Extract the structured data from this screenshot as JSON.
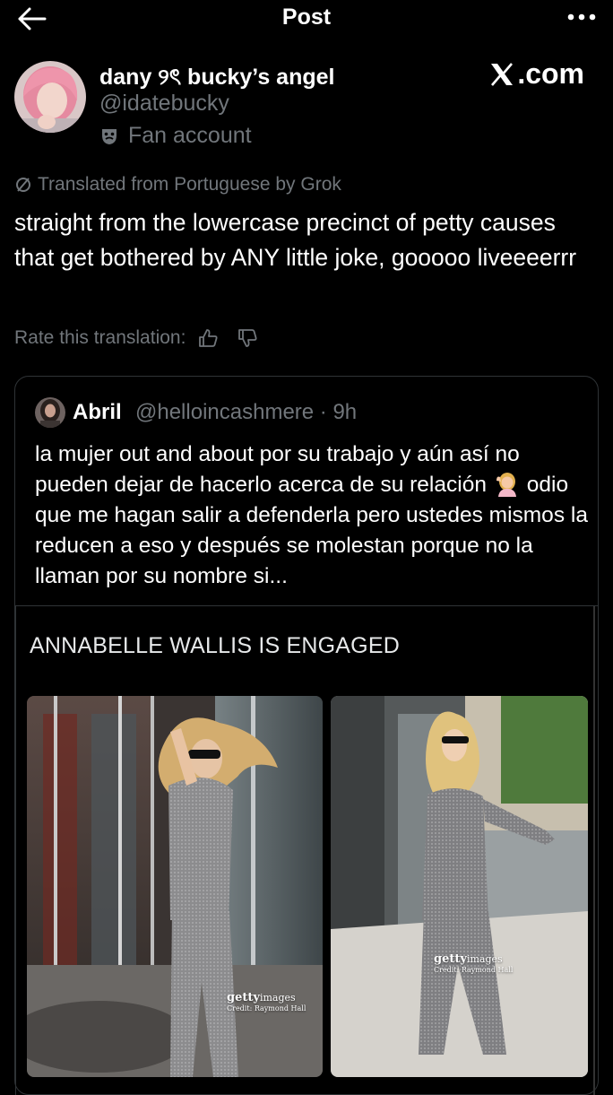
{
  "header": {
    "title": "Post",
    "back_icon": "arrow-left-icon",
    "more_icon": "more-horizontal-icon"
  },
  "post": {
    "display_name": "dany ୨ৎ bucky’s angel",
    "handle": "@idatebucky",
    "badge_label": "Fan account",
    "badge_icon": "theater-masks-icon",
    "watermark": ".com",
    "translated_label": "Translated from Portuguese by Grok",
    "text": "straight from the lowercase precinct of petty causes that get bothered by ANY little joke, gooooo liveeeerrr",
    "rate_label": "Rate this translation:"
  },
  "quote": {
    "display_name": "Abril",
    "meta": "@helloincashmere · 9h",
    "text": "la mujer out and about por su trabajo y aún así no pueden dejar de hacerlo acerca de su relación",
    "text_after_emoji": "odio que me hagan salir a defenderla pero ustedes mismos la reducen a eso y después se molestan porque no la llaman por su nombre si...",
    "emoji_icon": "person-tipping-hand-emoji",
    "card_title": "ANNABELLE WALLIS IS ENGAGED",
    "watermark_brand_1": "getty",
    "watermark_brand_2": "images",
    "watermark_credit": "Credit: Raymond Hall"
  }
}
